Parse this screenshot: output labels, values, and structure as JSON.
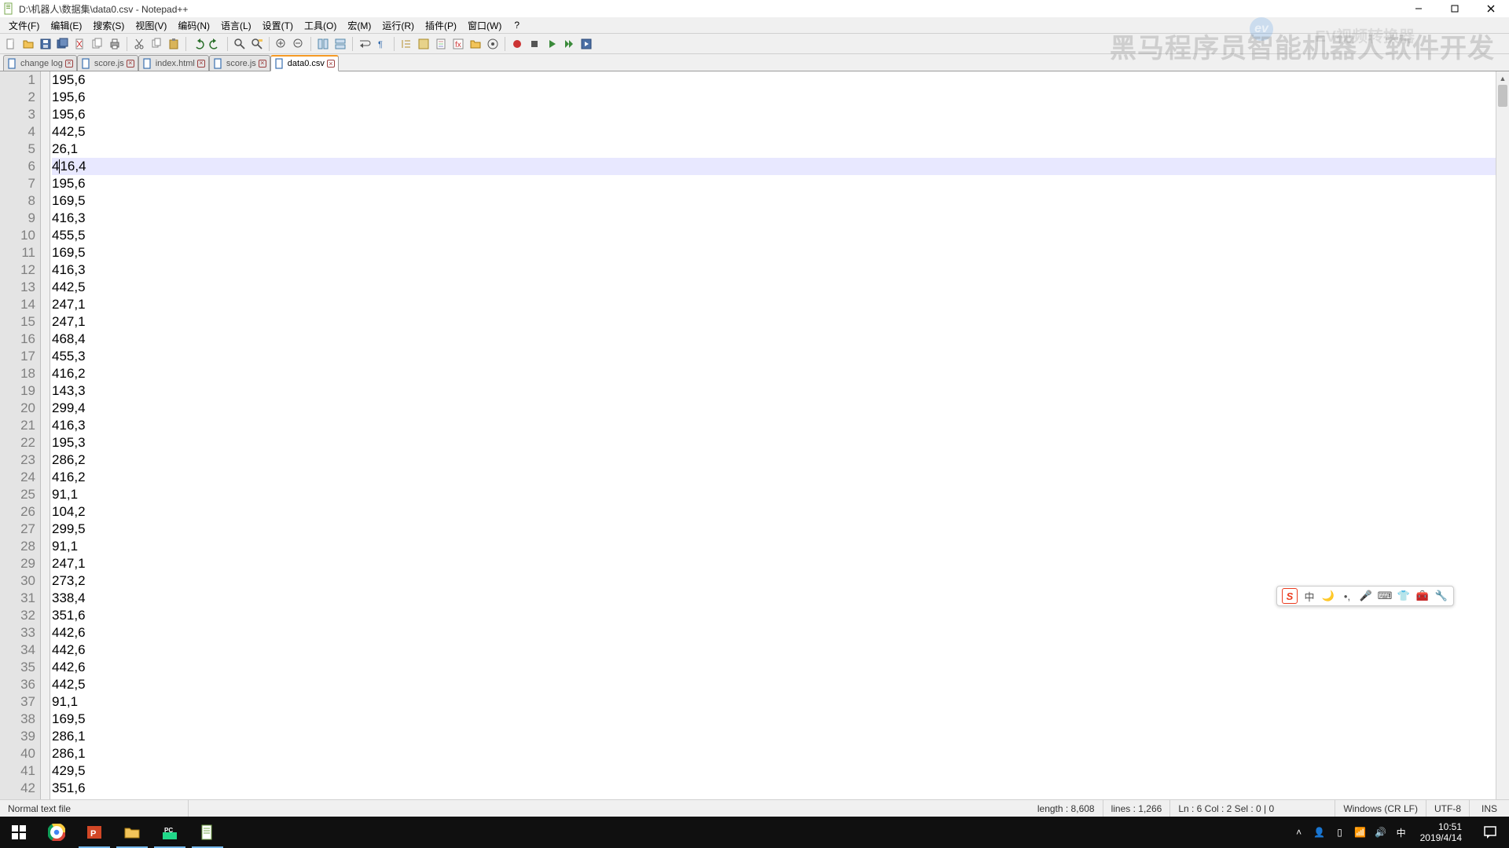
{
  "window": {
    "title": "D:\\机器人\\数据集\\data0.csv - Notepad++",
    "help": "?"
  },
  "menu": {
    "items": [
      "文件(F)",
      "编辑(E)",
      "搜索(S)",
      "视图(V)",
      "编码(N)",
      "语言(L)",
      "设置(T)",
      "工具(O)",
      "宏(M)",
      "运行(R)",
      "插件(P)",
      "窗口(W)"
    ]
  },
  "tabs": {
    "items": [
      {
        "label": "change log",
        "ext": ""
      },
      {
        "label": "score.js",
        "ext": ""
      },
      {
        "label": "index.html",
        "ext": ""
      },
      {
        "label": "score.js",
        "ext": ""
      },
      {
        "label": "data0.csv",
        "ext": ""
      }
    ],
    "active_index": 4
  },
  "editor": {
    "current_line_index": 5,
    "lines": [
      "195,6",
      "195,6",
      "195,6",
      "442,5",
      "26,1",
      "416,4",
      "195,6",
      "169,5",
      "416,3",
      "455,5",
      "169,5",
      "416,3",
      "442,5",
      "247,1",
      "247,1",
      "468,4",
      "455,3",
      "416,2",
      "143,3",
      "299,4",
      "416,3",
      "195,3",
      "286,2",
      "416,2",
      "91,1",
      "104,2",
      "299,5",
      "91,1",
      "247,1",
      "273,2",
      "338,4",
      "351,6",
      "442,6",
      "442,6",
      "442,6",
      "442,5",
      "91,1",
      "169,5",
      "286,1",
      "286,1",
      "429,5",
      "351,6"
    ],
    "caret_line6_prefix": "4",
    "caret_line6_suffix": "16,4"
  },
  "status": {
    "filetype": "Normal text file",
    "length_label": "length : 8,608",
    "lines_label": "lines : 1,266",
    "pos_label": "Ln : 6    Col : 2    Sel : 0 | 0",
    "eol": "Windows (CR LF)",
    "encoding": "UTF-8",
    "ins": "INS"
  },
  "watermark": {
    "main": "黑马程序员智能机器人软件开发",
    "sub": "EV视频转换器"
  },
  "ime": {
    "logo": "S",
    "lang": "中"
  },
  "clock": {
    "time": "10:51",
    "date": "2019/4/14"
  },
  "tray": {
    "ime_label": "中"
  }
}
